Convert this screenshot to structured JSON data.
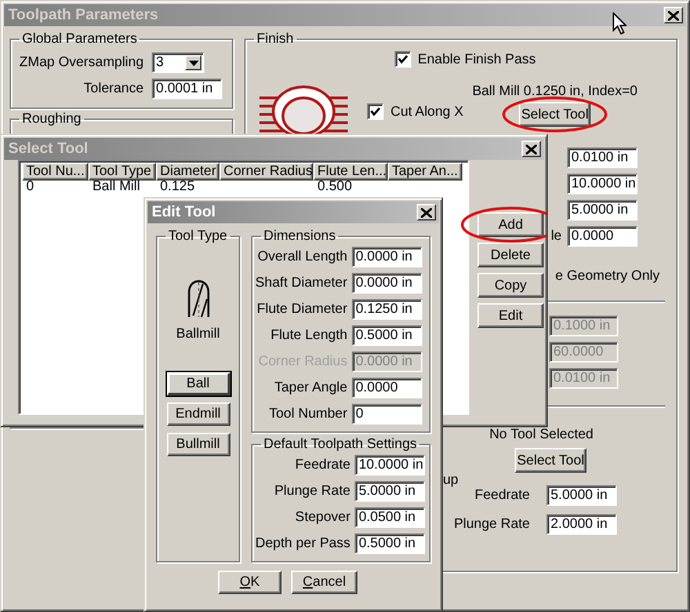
{
  "main_window": {
    "title": "Toolpath Parameters",
    "active": false
  },
  "global_parameters": {
    "title": "Global Parameters",
    "oversampling": {
      "label": "ZMap Oversampling",
      "value": "3"
    },
    "tolerance": {
      "label": "Tolerance",
      "value": "0.0001 in",
      "disabled": false
    }
  },
  "roughing": {
    "title": "Roughing"
  },
  "finish": {
    "title": "Finish",
    "enable_finish_pass": {
      "label": "Enable Finish Pass",
      "checked": true
    },
    "cut_along_x": {
      "label": "Cut Along X",
      "checked": true
    },
    "tool_label": "Ball Mill 0.1250 in, Index=0",
    "select_tool_button": {
      "label": "Select Tool",
      "circled": true
    },
    "fields": [
      {
        "value": "0.0100 in",
        "disabled": false
      },
      {
        "value": "10.0000 in",
        "disabled": false
      },
      {
        "value": "5.0000 in",
        "disabled": false
      },
      {
        "label": "le",
        "value": "0.0000",
        "disabled": false
      }
    ],
    "geometry_option": "e Geometry Only",
    "disabled_fields": [
      {
        "value": "0.1000 in",
        "disabled": true
      },
      {
        "value": "60.0000",
        "disabled": true
      },
      {
        "value": "0.0100 in",
        "disabled": true
      }
    ],
    "tool_status": "No Tool Selected",
    "second_select_tool_button": {
      "label": "Select Tool",
      "circled": false
    },
    "group_label_fragment": "up",
    "feed_fields": [
      {
        "label": "Feedrate",
        "value": "5.0000 in",
        "disabled": false
      },
      {
        "label": "Plunge Rate",
        "value": "2.0000 in",
        "disabled": false
      }
    ]
  },
  "select_tool_dialog": {
    "title": "Select Tool",
    "active": false,
    "columns": [
      "Tool Nu...",
      "Tool Type",
      "Diameter",
      "Corner Radius",
      "Flute Len...",
      "Taper An..."
    ],
    "rows": [
      {
        "cells": [
          "0",
          "Ball Mill",
          "0.125",
          null,
          "0.500",
          null
        ],
        "selected": false
      }
    ],
    "buttons": [
      {
        "label": "Add",
        "circled": true
      },
      {
        "label": "Delete",
        "circled": false
      },
      {
        "label": "Copy",
        "circled": false
      },
      {
        "label": "Edit",
        "circled": false
      }
    ]
  },
  "edit_tool_dialog": {
    "title": "Edit Tool",
    "active": true,
    "tool_type": {
      "title": "Tool Type",
      "name": "Ballmill",
      "buttons": [
        {
          "label": "Ball",
          "selected": true
        },
        {
          "label": "Endmill",
          "selected": false
        },
        {
          "label": "Bullmill",
          "selected": false
        }
      ]
    },
    "dimensions": {
      "title": "Dimensions",
      "fields": [
        {
          "label": "Overall Length",
          "value": "0.0000 in",
          "disabled": false
        },
        {
          "label": "Shaft Diameter",
          "value": "0.0000 in",
          "disabled": false
        },
        {
          "label": "Flute Diameter",
          "value": "0.1250 in",
          "disabled": false
        },
        {
          "label": "Flute Length",
          "value": "0.5000 in",
          "disabled": false
        },
        {
          "label": "Corner Radius",
          "value": "0.0000 in",
          "disabled": true
        },
        {
          "label": "Taper Angle",
          "value": "0.0000",
          "disabled": false
        },
        {
          "label": "Tool Number",
          "value": "0",
          "disabled": false
        }
      ]
    },
    "defaults": {
      "title": "Default Toolpath Settings",
      "fields": [
        {
          "label": "Feedrate",
          "value": "10.0000 in",
          "disabled": false
        },
        {
          "label": "Plunge Rate",
          "value": "5.0000 in",
          "disabled": false
        },
        {
          "label": "Stepover",
          "value": "0.0500 in",
          "disabled": false
        },
        {
          "label": "Depth per Pass",
          "value": "0.5000 in",
          "disabled": false
        }
      ]
    },
    "buttons": [
      {
        "label": "OK",
        "mnemonic_underlined": true
      },
      {
        "label": "Cancel",
        "mnemonic_underlined": true
      }
    ]
  }
}
